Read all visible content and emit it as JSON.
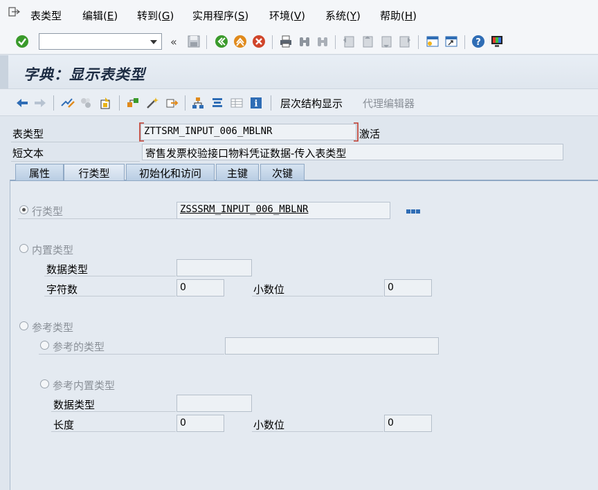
{
  "menu": {
    "items": [
      {
        "text": "表类型",
        "key": ""
      },
      {
        "text": "编辑",
        "key": "E"
      },
      {
        "text": "转到",
        "key": "G"
      },
      {
        "text": "实用程序",
        "key": "S"
      },
      {
        "text": "环境",
        "key": "V"
      },
      {
        "text": "系统",
        "key": "Y"
      },
      {
        "text": "帮助",
        "key": "H"
      }
    ]
  },
  "toolbar": {
    "command_value": "",
    "colors": {
      "green": "#3a9a2b",
      "orange": "#e08a1c",
      "red": "#d0452a",
      "blue": "#2f6db5"
    }
  },
  "title": "字典：显示表类型",
  "app_toolbar": {
    "hierarchy_label": "层次结构显示",
    "proxy_label": "代理编辑器"
  },
  "header": {
    "table_type_label": "表类型",
    "table_type_value": "ZTTSRM_INPUT_006_MBLNR",
    "status": "激活",
    "short_text_label": "短文本",
    "short_text_value": "寄售发票校验接口物料凭证数据-传入表类型"
  },
  "tabs": [
    "属性",
    "行类型",
    "初始化和访问",
    "主键",
    "次键"
  ],
  "line_type": {
    "label": "行类型",
    "value": "ZSSSRM_INPUT_006_MBLNR"
  },
  "builtin": {
    "label": "内置类型",
    "data_type_label": "数据类型",
    "data_type_value": "",
    "chars_label": "字符数",
    "chars_value": "0",
    "decimals_label": "小数位",
    "decimals_value": "0"
  },
  "reference": {
    "label": "参考类型",
    "ref_type_label": "参考的类型",
    "ref_type_value": "",
    "ref_builtin_label": "参考内置类型",
    "data_type_label": "数据类型",
    "data_type_value": "",
    "length_label": "长度",
    "length_value": "0",
    "decimals_label": "小数位",
    "decimals_value": "0"
  }
}
